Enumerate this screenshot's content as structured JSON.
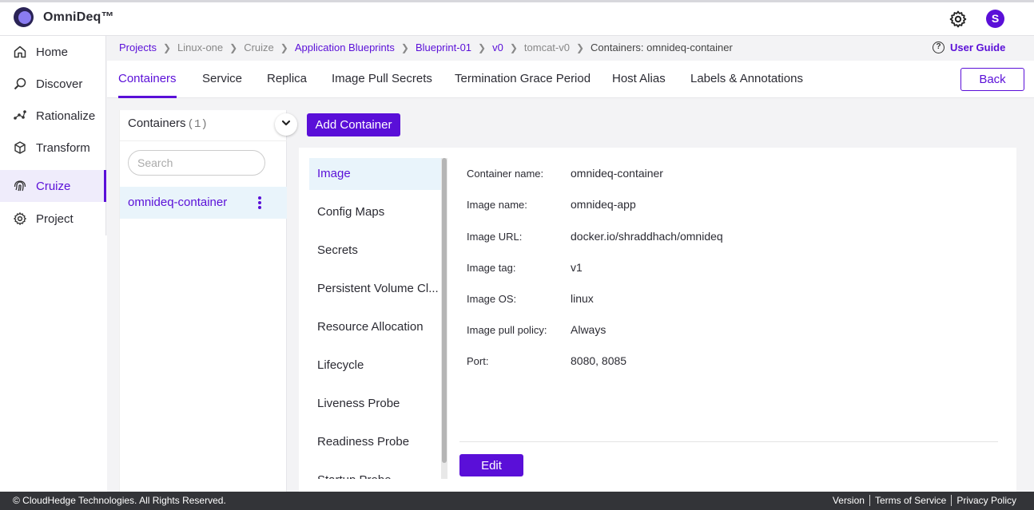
{
  "header": {
    "brand": "OmniDeq™",
    "avatar_initial": "S"
  },
  "sidebar": {
    "items": [
      {
        "label": "Home",
        "icon": "home-icon"
      },
      {
        "label": "Discover",
        "icon": "discover-icon"
      },
      {
        "label": "Rationalize",
        "icon": "rationalize-icon"
      },
      {
        "label": "Transform",
        "icon": "cube-icon"
      },
      {
        "label": "Cruize",
        "icon": "fingerprint-icon",
        "active": true
      },
      {
        "label": "Project",
        "icon": "gear-icon"
      }
    ]
  },
  "breadcrumb": [
    "Projects",
    "Linux-one",
    "Cruize",
    "Application Blueprints",
    "Blueprint-01",
    "v0",
    "tomcat-v0",
    "Containers: omnideq-container"
  ],
  "user_guide": "User Guide",
  "tabs": [
    "Containers",
    "Service",
    "Replica",
    "Image Pull Secrets",
    "Termination Grace Period",
    "Host Alias",
    "Labels & Annotations"
  ],
  "back_label": "Back",
  "containers": {
    "title": "Containers",
    "count": "(1)",
    "search_placeholder": "Search",
    "items": [
      "omnideq-container"
    ]
  },
  "add_container_label": "Add Container",
  "subnav": [
    "Image",
    "Config Maps",
    "Secrets",
    "Persistent Volume Cl...",
    "Resource Allocation",
    "Lifecycle",
    "Liveness Probe",
    "Readiness Probe",
    "Startup Probe"
  ],
  "details": [
    {
      "label": "Container name:",
      "value": "omnideq-container"
    },
    {
      "label": "Image name:",
      "value": "omnideq-app"
    },
    {
      "label": "Image URL:",
      "value": "docker.io/shraddhach/omnideq"
    },
    {
      "label": "Image tag:",
      "value": "v1"
    },
    {
      "label": "Image OS:",
      "value": "linux"
    },
    {
      "label": "Image pull policy:",
      "value": "Always"
    },
    {
      "label": "Port:",
      "value": "8080, 8085"
    }
  ],
  "edit_label": "Edit",
  "footer": {
    "copyright": "© CloudHedge Technologies. All Rights Reserved.",
    "links": [
      "Version",
      "Terms of Service",
      "Privacy Policy"
    ]
  },
  "colors": {
    "accent": "#5a0fd8",
    "selected_bg": "#e9f4fb",
    "footer_bg": "#333438"
  }
}
